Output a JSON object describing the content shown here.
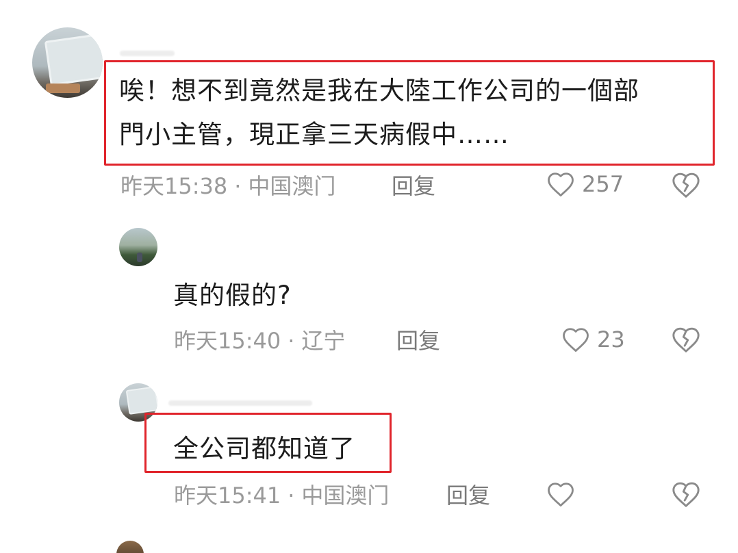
{
  "comments": [
    {
      "text_lines": [
        "唉！想不到竟然是我在大陸工作公司的一個部",
        "門小主管，現正拿三天病假中……"
      ],
      "time": "昨天15:38",
      "location": "中国澳门",
      "reply_label": "回复",
      "likes": "257",
      "highlighted": true
    },
    {
      "text_lines": [
        "真的假的?"
      ],
      "time": "昨天15:40",
      "location": "辽宁",
      "reply_label": "回复",
      "likes": "23",
      "highlighted": false
    },
    {
      "text_lines": [
        "全公司都知道了"
      ],
      "time": "昨天15:41",
      "location": "中国澳门",
      "reply_label": "回复",
      "likes": "",
      "highlighted": true
    }
  ],
  "meta_separator": "·",
  "colors": {
    "highlight": "#e0242b",
    "text": "#1c1c1c",
    "meta": "#9a9a9a"
  },
  "icons": {
    "like": "heart-outline-icon",
    "dislike": "broken-heart-icon"
  }
}
